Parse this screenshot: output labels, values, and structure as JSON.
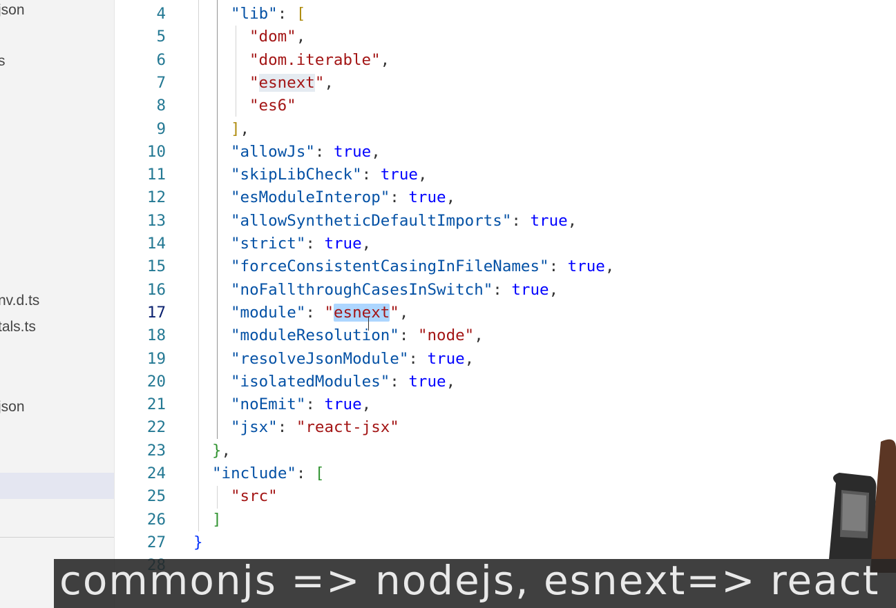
{
  "sidebar": {
    "items": [
      {
        "label": "json"
      },
      {
        "label": "s"
      },
      {
        "label": "nv.d.ts"
      },
      {
        "label": "tals.ts"
      },
      {
        "label": "json"
      }
    ]
  },
  "editor": {
    "active_line": 17,
    "lines": [
      {
        "num": "4",
        "tokens": [
          [
            "k",
            "\"lib\""
          ],
          [
            "p",
            ": "
          ],
          [
            "br1",
            "["
          ]
        ]
      },
      {
        "num": "5",
        "tokens": [
          [
            "s",
            "\"dom\""
          ],
          [
            "p",
            ","
          ]
        ]
      },
      {
        "num": "6",
        "tokens": [
          [
            "s",
            "\"dom.iterable\""
          ],
          [
            "p",
            ","
          ]
        ]
      },
      {
        "num": "7",
        "tokens": [
          [
            "s",
            "\""
          ],
          [
            "s hl-soft",
            "esnext"
          ],
          [
            "s",
            "\""
          ],
          [
            "p",
            ","
          ]
        ]
      },
      {
        "num": "8",
        "tokens": [
          [
            "s",
            "\"es6\""
          ]
        ]
      },
      {
        "num": "9",
        "tokens": [
          [
            "br1",
            "]"
          ],
          [
            "p",
            ","
          ]
        ]
      },
      {
        "num": "10",
        "tokens": [
          [
            "k",
            "\"allowJs\""
          ],
          [
            "p",
            ": "
          ],
          [
            "b",
            "true"
          ],
          [
            "p",
            ","
          ]
        ]
      },
      {
        "num": "11",
        "tokens": [
          [
            "k",
            "\"skipLibCheck\""
          ],
          [
            "p",
            ": "
          ],
          [
            "b",
            "true"
          ],
          [
            "p",
            ","
          ]
        ]
      },
      {
        "num": "12",
        "tokens": [
          [
            "k",
            "\"esModuleInterop\""
          ],
          [
            "p",
            ": "
          ],
          [
            "b",
            "true"
          ],
          [
            "p",
            ","
          ]
        ]
      },
      {
        "num": "13",
        "tokens": [
          [
            "k",
            "\"allowSyntheticDefaultImports\""
          ],
          [
            "p",
            ": "
          ],
          [
            "b",
            "true"
          ],
          [
            "p",
            ","
          ]
        ]
      },
      {
        "num": "14",
        "tokens": [
          [
            "k",
            "\"strict\""
          ],
          [
            "p",
            ": "
          ],
          [
            "b",
            "true"
          ],
          [
            "p",
            ","
          ]
        ]
      },
      {
        "num": "15",
        "tokens": [
          [
            "k",
            "\"forceConsistentCasingInFileNames\""
          ],
          [
            "p",
            ": "
          ],
          [
            "b",
            "true"
          ],
          [
            "p",
            ","
          ]
        ]
      },
      {
        "num": "16",
        "tokens": [
          [
            "k",
            "\"noFallthroughCasesInSwitch\""
          ],
          [
            "p",
            ": "
          ],
          [
            "b",
            "true"
          ],
          [
            "p",
            ","
          ]
        ]
      },
      {
        "num": "17",
        "tokens": [
          [
            "k",
            "\"module\""
          ],
          [
            "p",
            ": "
          ],
          [
            "s",
            "\""
          ],
          [
            "s hl",
            "esnext"
          ],
          [
            "s",
            "\""
          ],
          [
            "p",
            ","
          ]
        ]
      },
      {
        "num": "18",
        "tokens": [
          [
            "k",
            "\"moduleResolution\""
          ],
          [
            "p",
            ": "
          ],
          [
            "s",
            "\"node\""
          ],
          [
            "p",
            ","
          ]
        ]
      },
      {
        "num": "19",
        "tokens": [
          [
            "k",
            "\"resolveJsonModule\""
          ],
          [
            "p",
            ": "
          ],
          [
            "b",
            "true"
          ],
          [
            "p",
            ","
          ]
        ]
      },
      {
        "num": "20",
        "tokens": [
          [
            "k",
            "\"isolatedModules\""
          ],
          [
            "p",
            ": "
          ],
          [
            "b",
            "true"
          ],
          [
            "p",
            ","
          ]
        ]
      },
      {
        "num": "21",
        "tokens": [
          [
            "k",
            "\"noEmit\""
          ],
          [
            "p",
            ": "
          ],
          [
            "b",
            "true"
          ],
          [
            "p",
            ","
          ]
        ]
      },
      {
        "num": "22",
        "tokens": [
          [
            "k",
            "\"jsx\""
          ],
          [
            "p",
            ": "
          ],
          [
            "s",
            "\"react-jsx\""
          ]
        ]
      },
      {
        "num": "23",
        "tokens": [
          [
            "br2",
            "}"
          ],
          [
            "p",
            ","
          ]
        ]
      },
      {
        "num": "24",
        "tokens": [
          [
            "k",
            "\"include\""
          ],
          [
            "p",
            ": "
          ],
          [
            "br2",
            "["
          ]
        ]
      },
      {
        "num": "25",
        "tokens": [
          [
            "s",
            "\"src\""
          ]
        ]
      },
      {
        "num": "26",
        "tokens": [
          [
            "br2",
            "]"
          ]
        ]
      },
      {
        "num": "27",
        "tokens": [
          [
            "br0",
            "}"
          ]
        ]
      },
      {
        "num": "28",
        "tokens": []
      }
    ]
  },
  "caption": {
    "text": "commonjs => nodejs,  esnext=> react"
  }
}
